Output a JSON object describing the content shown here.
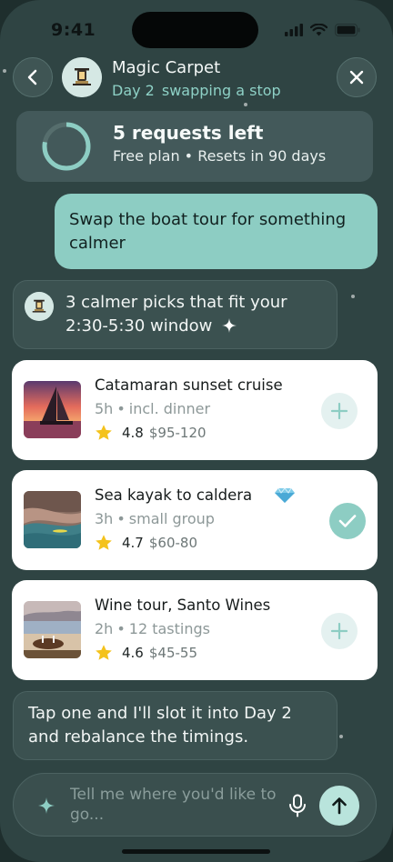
{
  "status_bar": {
    "time": "9:41",
    "icons": [
      "signal-icon",
      "wifi-icon",
      "battery-icon"
    ]
  },
  "header": {
    "back_icon": "chevron-left-icon",
    "app_name": "Magic Carpet",
    "day": "Day 2",
    "subtitle": "swapping a stop",
    "close_icon": "close-icon"
  },
  "quota": {
    "title": "5 requests left",
    "subtitle": "Free plan • Resets in 90 days",
    "progress_fraction": 0.78
  },
  "messages": {
    "user": "Swap the boat tour for something calmer",
    "bot_intro": "3 calmer picks that fit your 2:30-5:30 window",
    "bot_followup": "Tap one and I'll slot it into Day 2 and rebalance the timings."
  },
  "options": [
    {
      "title": "Catamaran sunset cruise",
      "duration": "5h",
      "detail": "incl. dinner",
      "rating": "4.8",
      "price": "$95-120",
      "state": "add"
    },
    {
      "title": "Sea kayak to caldera",
      "duration": "3h",
      "detail": "small group",
      "rating": "4.7",
      "price": "$60-80",
      "state": "selected",
      "badge_icon": "gem-icon"
    },
    {
      "title": "Wine tour, Santo Wines",
      "duration": "2h",
      "detail": "12 tastings",
      "rating": "4.6",
      "price": "$45-55",
      "state": "add"
    }
  ],
  "composer": {
    "placeholder": "Tell me where you'd like to go...",
    "leading_icon": "sparkle-icon",
    "mic_icon": "microphone-icon",
    "send_icon": "arrow-up-icon"
  },
  "colors": {
    "background": "#2f4443",
    "accent": "#8dcdc3",
    "card": "#ffffff",
    "star": "#f4c21c"
  }
}
